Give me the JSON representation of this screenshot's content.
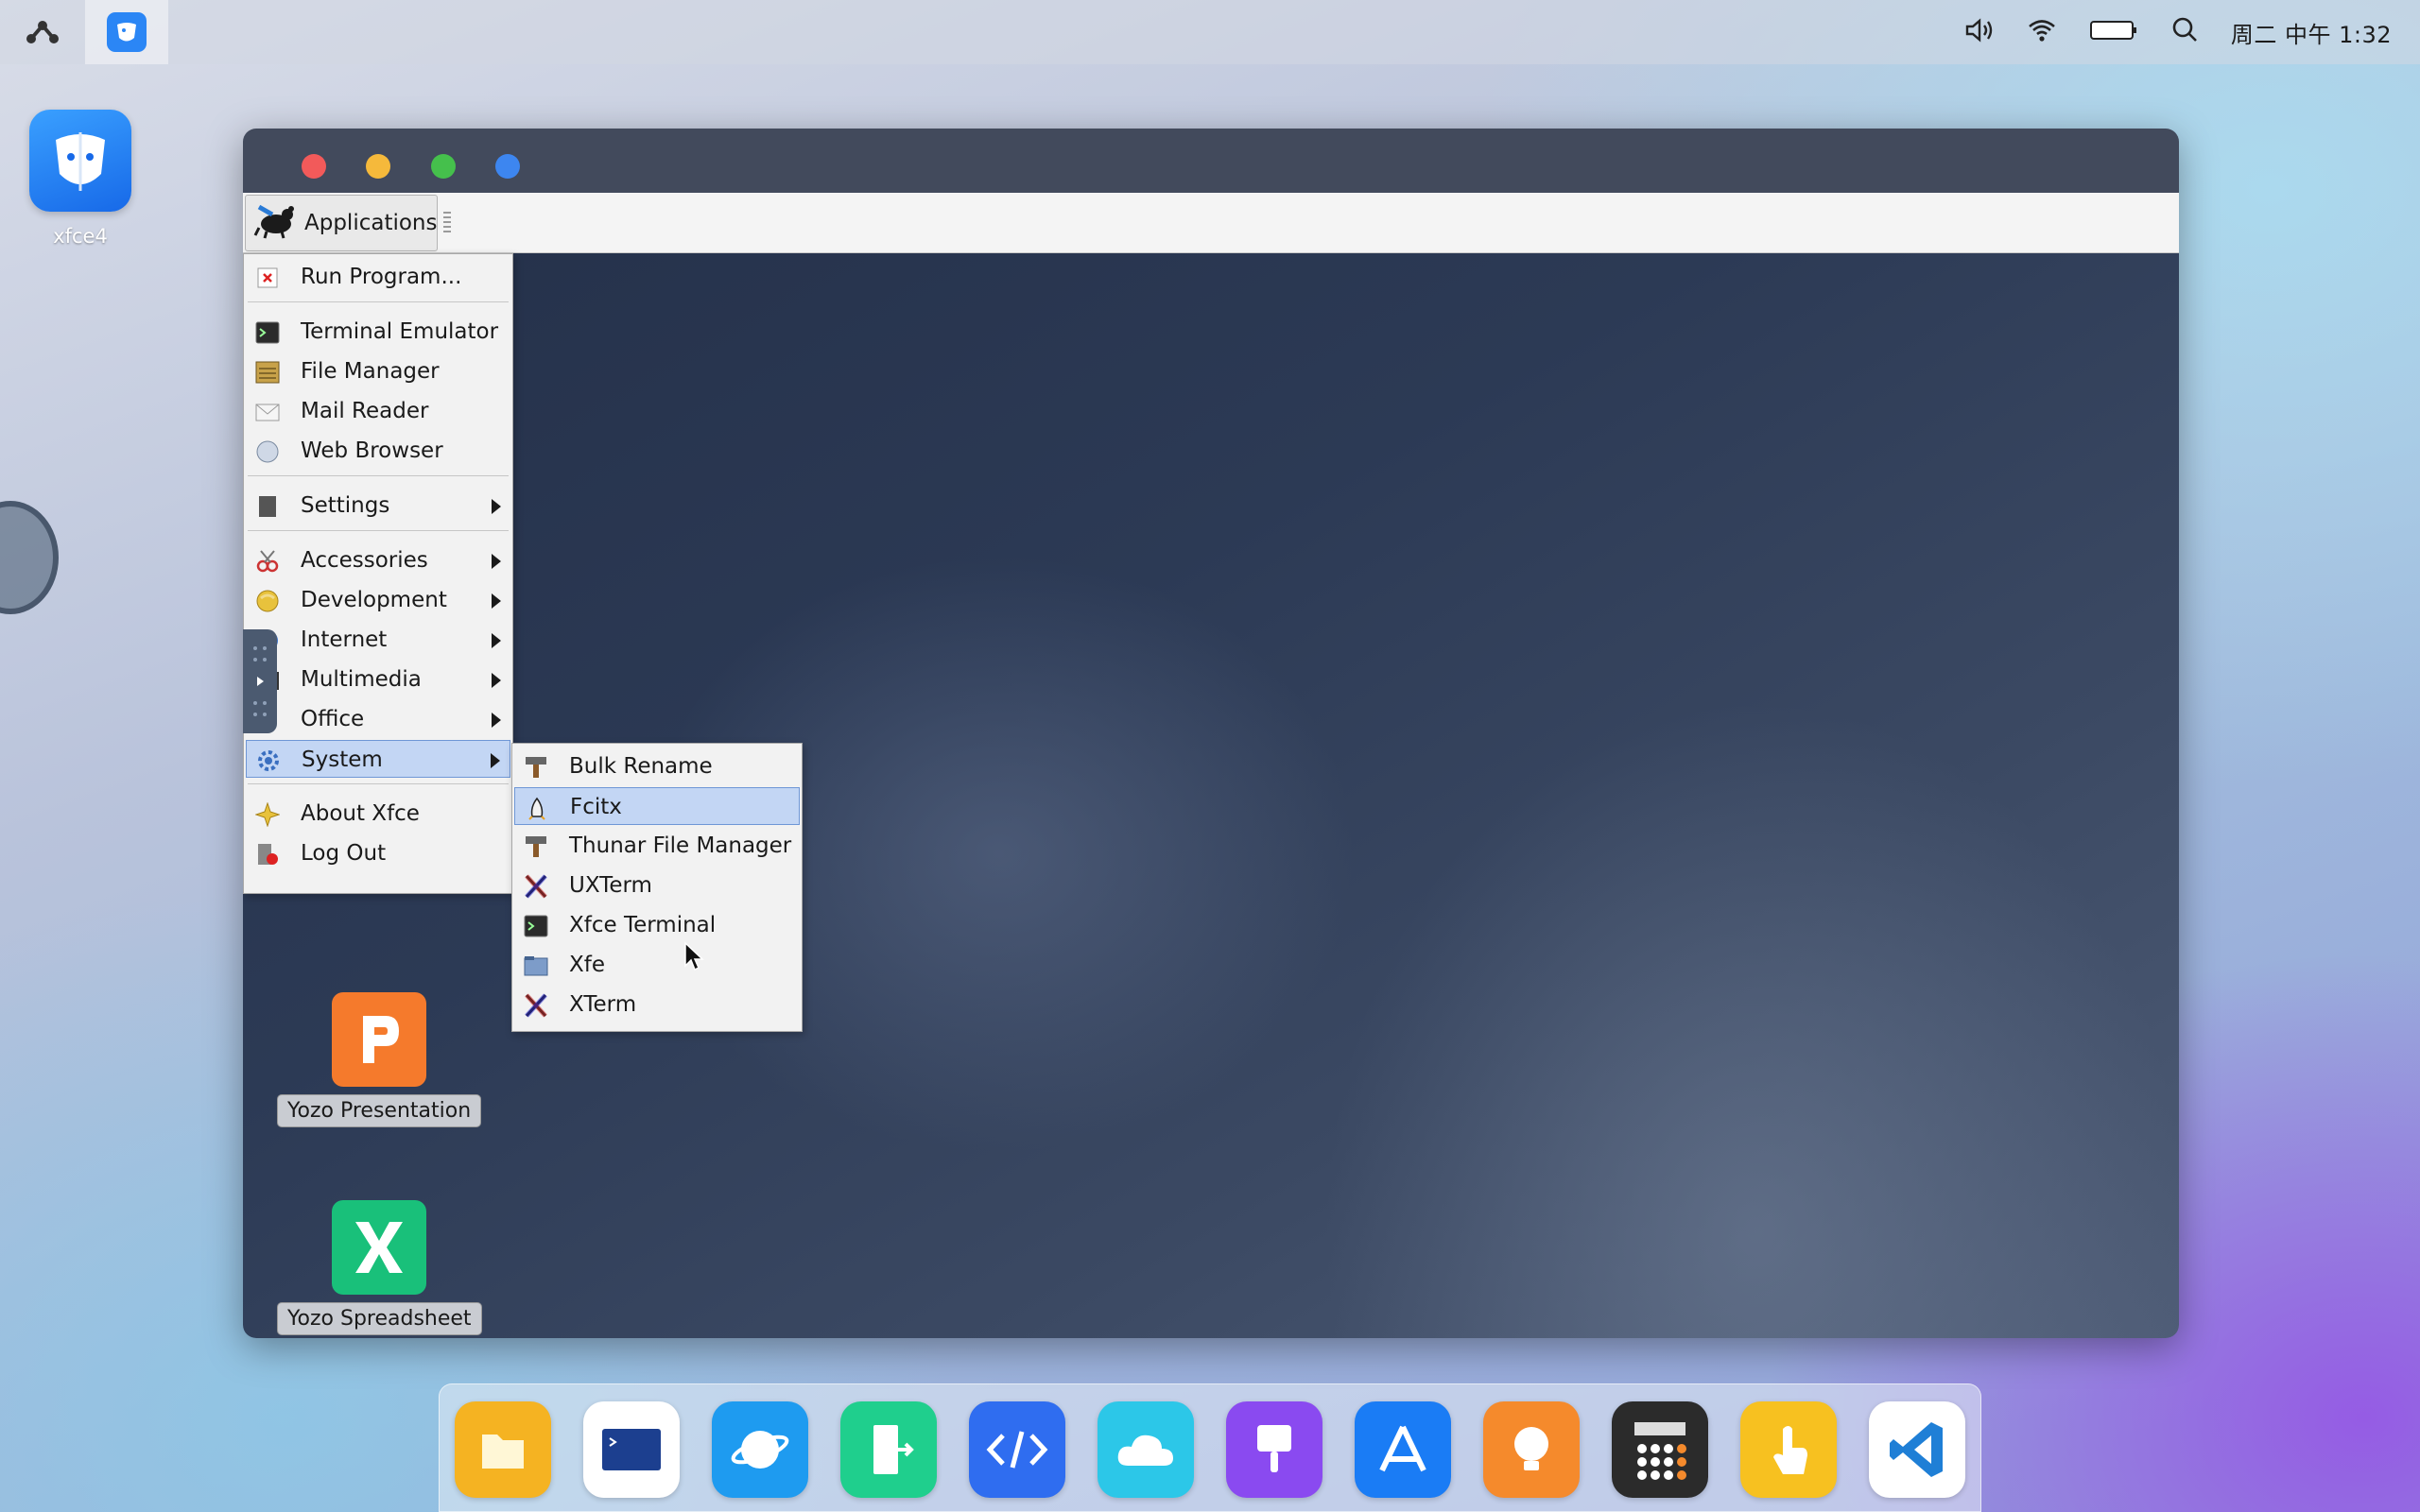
{
  "topbar": {
    "clock": "周二 中午 1:32",
    "icons": [
      "system-logo-icon",
      "app-tab-icon",
      "volume-icon",
      "wifi-icon",
      "battery-icon",
      "search-icon"
    ]
  },
  "desktop": {
    "icon_label": "xfce4"
  },
  "window": {
    "traffic_lights": [
      "#f25a5a",
      "#f5b93b",
      "#45c04c",
      "#3d86f0"
    ],
    "applications_label": "Applications"
  },
  "app_menu": {
    "items": [
      {
        "label": "Run Program...",
        "icon": "run-program-icon"
      },
      {
        "label": "Terminal Emulator",
        "icon": "terminal-icon"
      },
      {
        "label": "File Manager",
        "icon": "file-manager-icon"
      },
      {
        "label": "Mail Reader",
        "icon": "mail-icon"
      },
      {
        "label": "Web Browser",
        "icon": "web-browser-icon"
      },
      {
        "label": "Settings",
        "icon": "settings-icon",
        "submenu": true
      },
      {
        "label": "Accessories",
        "icon": "accessories-icon",
        "submenu": true
      },
      {
        "label": "Development",
        "icon": "development-icon",
        "submenu": true
      },
      {
        "label": "Internet",
        "icon": "internet-icon",
        "submenu": true
      },
      {
        "label": "Multimedia",
        "icon": "multimedia-icon",
        "submenu": true
      },
      {
        "label": "Office",
        "icon": "office-icon",
        "submenu": true
      },
      {
        "label": "System",
        "icon": "system-icon",
        "submenu": true,
        "selected": true
      },
      {
        "label": "About Xfce",
        "icon": "about-xfce-icon"
      },
      {
        "label": "Log Out",
        "icon": "log-out-icon"
      }
    ]
  },
  "system_menu": {
    "items": [
      {
        "label": "Bulk Rename",
        "icon": "bulk-rename-icon"
      },
      {
        "label": "Fcitx",
        "icon": "fcitx-icon",
        "selected": true
      },
      {
        "label": "Thunar File Manager",
        "icon": "thunar-icon"
      },
      {
        "label": "UXTerm",
        "icon": "uxterm-icon"
      },
      {
        "label": "Xfce Terminal",
        "icon": "xfce-terminal-icon"
      },
      {
        "label": "Xfe",
        "icon": "xfe-icon"
      },
      {
        "label": "XTerm",
        "icon": "xterm-icon"
      }
    ]
  },
  "window_icons": [
    {
      "label": "Yozo Presentation",
      "icon": "yozo-presentation-icon",
      "color": "#f57a2c"
    },
    {
      "label": "Yozo Spreadsheet",
      "icon": "yozo-spreadsheet-icon",
      "color": "#19c07a"
    }
  ],
  "dock": {
    "items": [
      {
        "icon": "files-icon",
        "color": "#f5b322"
      },
      {
        "icon": "terminal-icon",
        "color": "#ffffff"
      },
      {
        "icon": "browser-icon",
        "color": "#1e9bf0"
      },
      {
        "icon": "exit-icon",
        "color": "#1fcf8d"
      },
      {
        "icon": "code-icon",
        "color": "#2f6df0"
      },
      {
        "icon": "cloud-icon",
        "color": "#2cc7e8"
      },
      {
        "icon": "paint-icon",
        "color": "#8a4af0"
      },
      {
        "icon": "app-store-icon",
        "color": "#1a7cf5"
      },
      {
        "icon": "tips-icon",
        "color": "#f58a2c"
      },
      {
        "icon": "calculator-icon",
        "color": "#2b2b2b"
      },
      {
        "icon": "touch-icon",
        "color": "#f7c120"
      },
      {
        "icon": "vscode-icon",
        "color": "#ffffff"
      }
    ]
  }
}
